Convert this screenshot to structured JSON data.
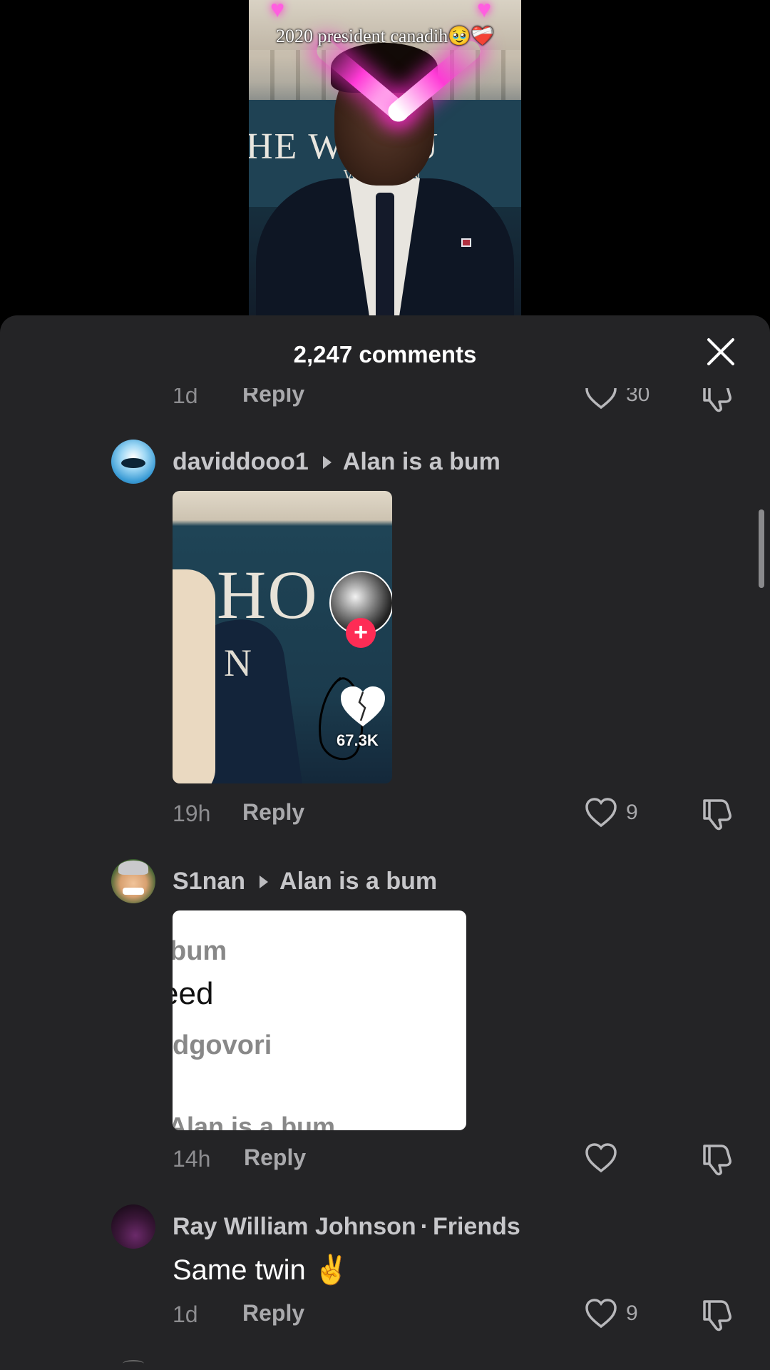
{
  "video": {
    "caption": "2020 president canadih🥹❤️‍🩹",
    "sign_text": "HE W    HOU",
    "sign_sub": "WA      ON",
    "heart_deco": "♥"
  },
  "sheet": {
    "title": "2,247 comments"
  },
  "comments": [
    {
      "time": "1d",
      "reply_label": "Reply",
      "likes": "30"
    },
    {
      "username": "daviddooo1",
      "replying_to": "Alan is a bum",
      "attachment": {
        "type": "video",
        "text_big": "HO",
        "text_small": "N",
        "plus": "+",
        "like_count": "67.3K"
      },
      "time": "19h",
      "reply_label": "Reply",
      "likes": "9"
    },
    {
      "username": "S1nan",
      "replying_to": "Alan is a bum",
      "attachment": {
        "type": "text-screenshot",
        "lines": [
          "bum",
          "eed",
          "dgovori",
          "Alan is a bum"
        ]
      },
      "time": "14h",
      "reply_label": "Reply",
      "likes": ""
    },
    {
      "username": "Ray William Johnson",
      "tag": "Friends",
      "separator": "·",
      "text": "Same twin ✌️",
      "time": "1d",
      "reply_label": "Reply",
      "likes": "9"
    }
  ],
  "icons": {
    "close": "close-icon",
    "like": "heart-outline-icon",
    "dislike": "thumbs-down-icon"
  },
  "colors": {
    "sheet_bg": "#242426",
    "accent_plus": "#fe2c55",
    "muted_text": "#8d8d90"
  }
}
